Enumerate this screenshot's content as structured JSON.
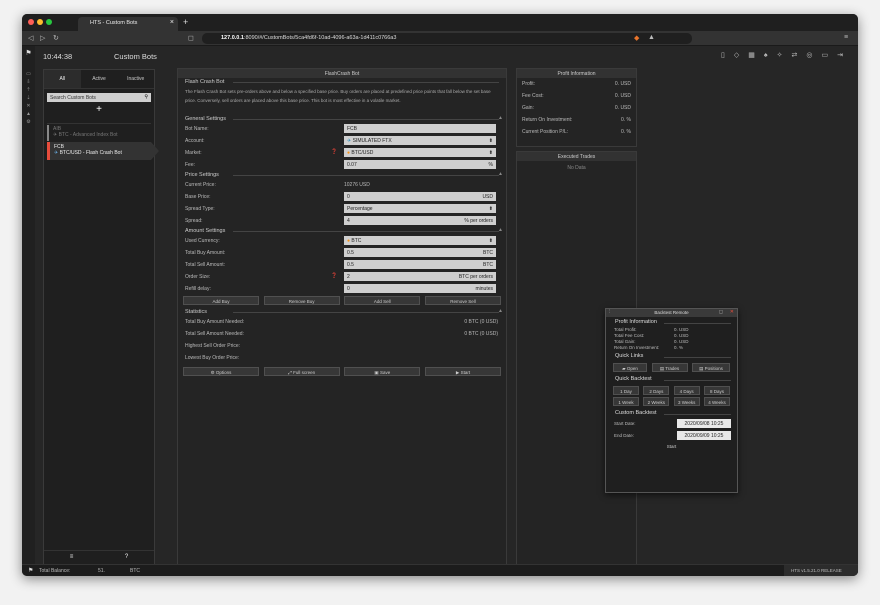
{
  "browser": {
    "tab_title": "HTS - Custom Bots",
    "tab_close": "×",
    "new_tab": "+",
    "url_host": "127.0.0.1",
    "url_rest": ":8090/#/CustomBots/5ca4fd6f-10ad-4096-a63a-1d411c0766a3"
  },
  "header": {
    "time": "10:44:38",
    "title": "Custom Bots"
  },
  "bots_panel": {
    "tabs": [
      "All",
      "Active",
      "Inactive"
    ],
    "search_placeholder": "Search Custom Bots",
    "add_label": "+",
    "items": [
      {
        "name": "AIB",
        "sub": "BTC - Advanced Index Bot"
      },
      {
        "name": "FCB",
        "sub": "BTC/USD - Flash Crash Bot"
      }
    ],
    "footer": [
      "≡",
      "?"
    ]
  },
  "main": {
    "header": "FlashCrash Bot",
    "bot_section": "Flash Crash Bot",
    "description": "The Flash Crash Bot sets pre-orders above and below a specified base price. Buy orders are placed at predefined price points that fall below the set base price. Conversely, sell orders are placed above this base price. This bot is most effective in a volatile market.",
    "more_info": "More Info",
    "general": {
      "title": "General Settings",
      "bot_name_label": "Bot Name:",
      "bot_name": "FCB",
      "account_label": "Account:",
      "account": "SIMULATED FTX",
      "market_label": "Market:",
      "market": "BTC/USD",
      "fee_label": "Fee:",
      "fee": "0.07",
      "fee_unit": "%"
    },
    "price": {
      "title": "Price Settings",
      "current_label": "Current Price:",
      "current": "10276 USD",
      "base_label": "Base Price:",
      "base": "0",
      "base_unit": "USD",
      "spread_type_label": "Spread Type:",
      "spread_type": "Percentage",
      "spread_label": "Spread:",
      "spread": "4",
      "spread_unit": "% per orders"
    },
    "amount": {
      "title": "Amount Settings",
      "used_label": "Used Currency:",
      "used": "BTC",
      "buy_label": "Total Buy Amount:",
      "buy": "0.5",
      "buy_unit": "BTC",
      "sell_label": "Total Sell Amount:",
      "sell": "0.5",
      "sell_unit": "BTC",
      "order_label": "Order Size:",
      "order": "2",
      "order_unit": "BTC per orders",
      "refill_label": "Refill delay:",
      "refill": "0",
      "refill_unit": "minutes"
    },
    "amount_buttons": [
      "Add Buy",
      "Remove Buy",
      "Add Sell",
      "Remove Sell"
    ],
    "stats": {
      "title": "Statistics",
      "buy_needed_label": "Total Buy Amount Needed:",
      "buy_needed": "0 BTC (0 USD)",
      "sell_needed_label": "Total Sell Amount Needed:",
      "sell_needed": "0 BTC (0 USD)",
      "highest_label": "Highest Sell Order Price:",
      "lowest_label": "Lowest Buy Order Price:"
    },
    "footer_buttons": [
      "Options",
      "Full screen",
      "Save",
      "Start"
    ]
  },
  "profit": {
    "title": "Profit Information",
    "rows": [
      {
        "label": "Profit:",
        "value": "0.",
        "unit": "USD"
      },
      {
        "label": "Fee Cost:",
        "value": "0.",
        "unit": "USD"
      },
      {
        "label": "Gain:",
        "value": "0.",
        "unit": "USD"
      },
      {
        "label": "Return On Investment:",
        "value": "0.",
        "unit": "%"
      },
      {
        "label": "Current Position P/L:",
        "value": "0.",
        "unit": "%"
      }
    ]
  },
  "trades": {
    "title": "Executed Trades",
    "empty": "No Data"
  },
  "backtest": {
    "title": "Backtest Remote",
    "profit_title": "Profit Information",
    "rows": [
      {
        "label": "Total Profit:",
        "value": "0. USD"
      },
      {
        "label": "Total Fee Cost:",
        "value": "0. USD"
      },
      {
        "label": "Total Gain:",
        "value": "0. USD"
      },
      {
        "label": "Return On Investment:",
        "value": "0. %"
      }
    ],
    "links_title": "Quick Links",
    "links": [
      "Open",
      "Trades",
      "Positions"
    ],
    "quick_title": "Quick Backtest",
    "quick_row1": [
      "1 Day",
      "2 Days",
      "4 Days",
      "8 Days"
    ],
    "quick_row2": [
      "1 Week",
      "2 Weeks",
      "3 Weeks",
      "4 Weeks"
    ],
    "custom_title": "Custom Backtest",
    "start_label": "Start Date:",
    "start": "2020/09/08 10:25",
    "end_label": "End Date:",
    "end": "2020/09/09 10:25",
    "start_btn": "Start"
  },
  "status": {
    "balance_label": "Total Balance:",
    "balance_value": "51.",
    "balance_unit": "BTC",
    "release": "HTS v1.5.21.0 RELEASE"
  }
}
